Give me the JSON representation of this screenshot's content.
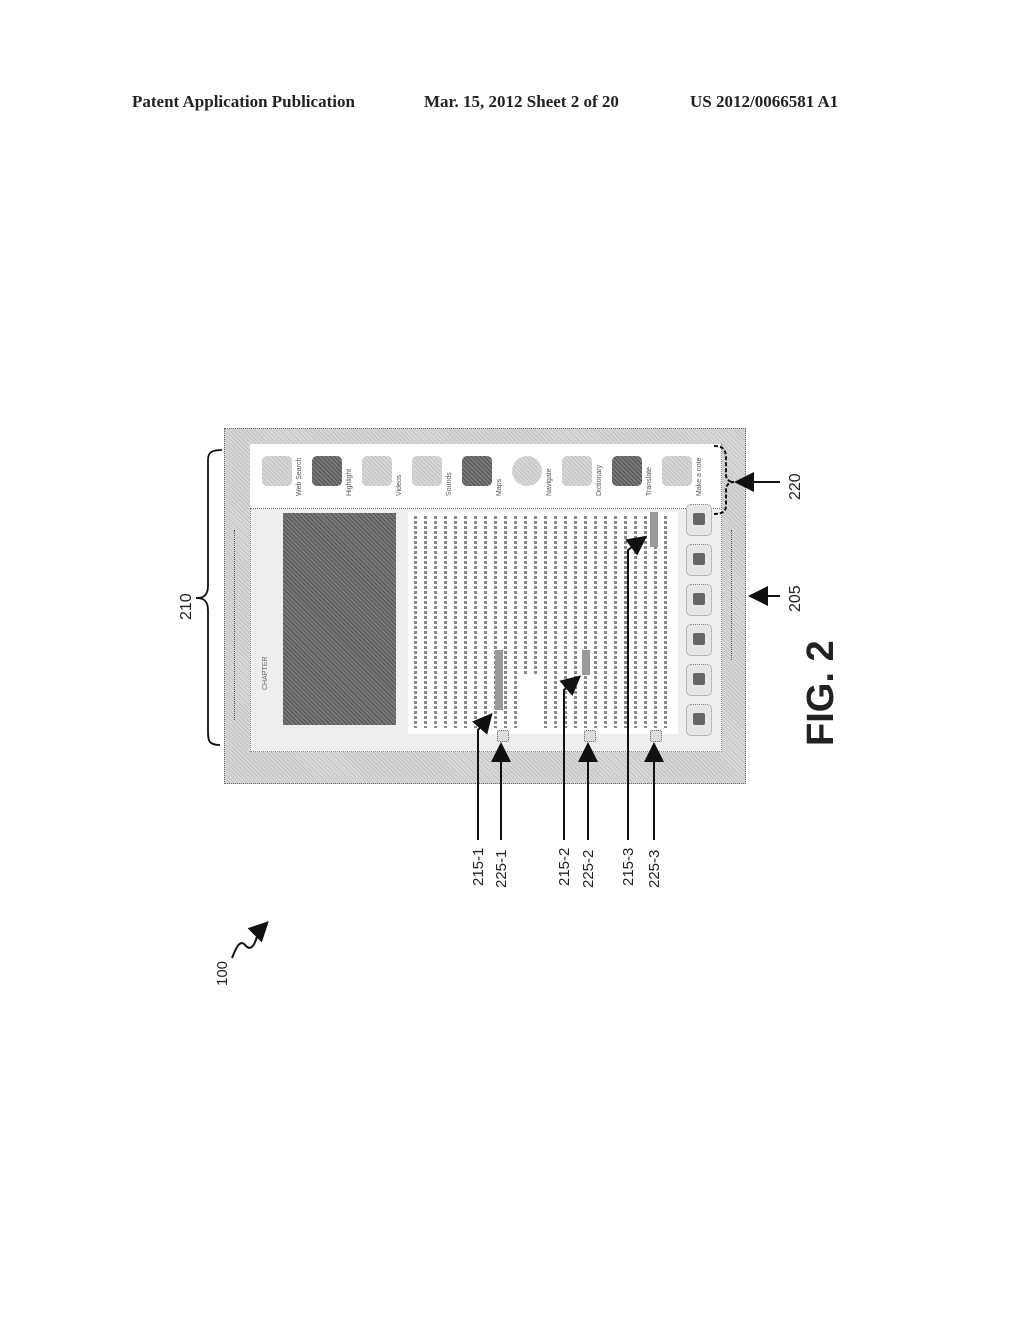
{
  "header": {
    "left": "Patent Application Publication",
    "center": "Mar. 15, 2012  Sheet 2 of 20",
    "right": "US 2012/0066581 A1"
  },
  "figure": {
    "caption": "FIG. 2",
    "orientation": "rotated 90° counter-clockwise",
    "reference_numerals": {
      "system": "100",
      "device": "205",
      "display": "210",
      "toolbar": "220",
      "annotations": [
        {
          "highlight": "215-1",
          "note_icon": "225-1"
        },
        {
          "highlight": "215-2",
          "note_icon": "225-2"
        },
        {
          "highlight": "215-3",
          "note_icon": "225-3"
        }
      ]
    },
    "screen": {
      "chapter_heading": "CHAPTER",
      "toolbar_items": [
        {
          "icon": "web-search-icon",
          "label": "Web Search"
        },
        {
          "icon": "highlight-icon",
          "label": "Highlight"
        },
        {
          "icon": "videos-icon",
          "label": "Videos"
        },
        {
          "icon": "sounds-icon",
          "label": "Sounds"
        },
        {
          "icon": "maps-icon",
          "label": "Maps"
        },
        {
          "icon": "navigate-icon",
          "label": "Navigate"
        },
        {
          "icon": "dictionary-icon",
          "label": "Dictionary"
        },
        {
          "icon": "translate-icon",
          "label": "Translate"
        },
        {
          "icon": "notes-icon",
          "label": "Make a note"
        }
      ],
      "nav_buttons": [
        "bookmark-icon",
        "previous-icon",
        "home-icon",
        "menu-icon",
        "next-icon",
        "up-icon"
      ]
    }
  }
}
